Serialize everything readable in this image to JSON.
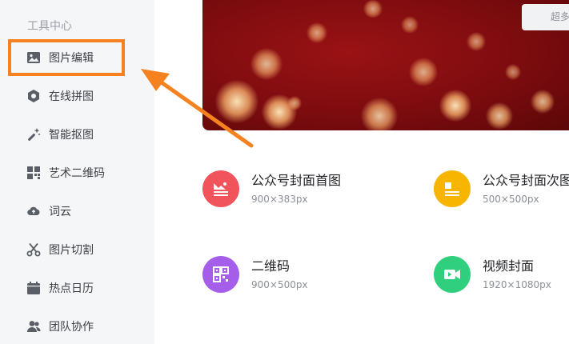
{
  "sidebar": {
    "heading": "工具中心",
    "items": [
      {
        "label": "图片编辑",
        "icon": "image-icon"
      },
      {
        "label": "在线拼图",
        "icon": "hexagon-icon"
      },
      {
        "label": "智能抠图",
        "icon": "magic-wand-icon"
      },
      {
        "label": "艺术二维码",
        "icon": "qr-code-icon"
      },
      {
        "label": "词云",
        "icon": "cloud-icon"
      },
      {
        "label": "图片切割",
        "icon": "scissors-icon"
      },
      {
        "label": "热点日历",
        "icon": "calendar-icon"
      },
      {
        "label": "团队协作",
        "icon": "team-icon"
      }
    ]
  },
  "banner": {
    "more_label": "超多"
  },
  "templates": [
    {
      "title": "公众号封面首图",
      "size": "900×383px",
      "color": "#f2545b",
      "icon": "image-text-icon"
    },
    {
      "title": "公众号封面次图",
      "size": "500×500px",
      "color": "#f7b500",
      "icon": "image-text-icon"
    },
    {
      "title": "二维码",
      "size": "900×500px",
      "color": "#a55eea",
      "icon": "qr-code-icon"
    },
    {
      "title": "视频封面",
      "size": "1920×1080px",
      "color": "#2fcf7d",
      "icon": "video-camera-icon"
    }
  ],
  "colors": {
    "highlight": "#f5821f",
    "arrow": "#f5821f",
    "banner": "#8a0e10"
  }
}
